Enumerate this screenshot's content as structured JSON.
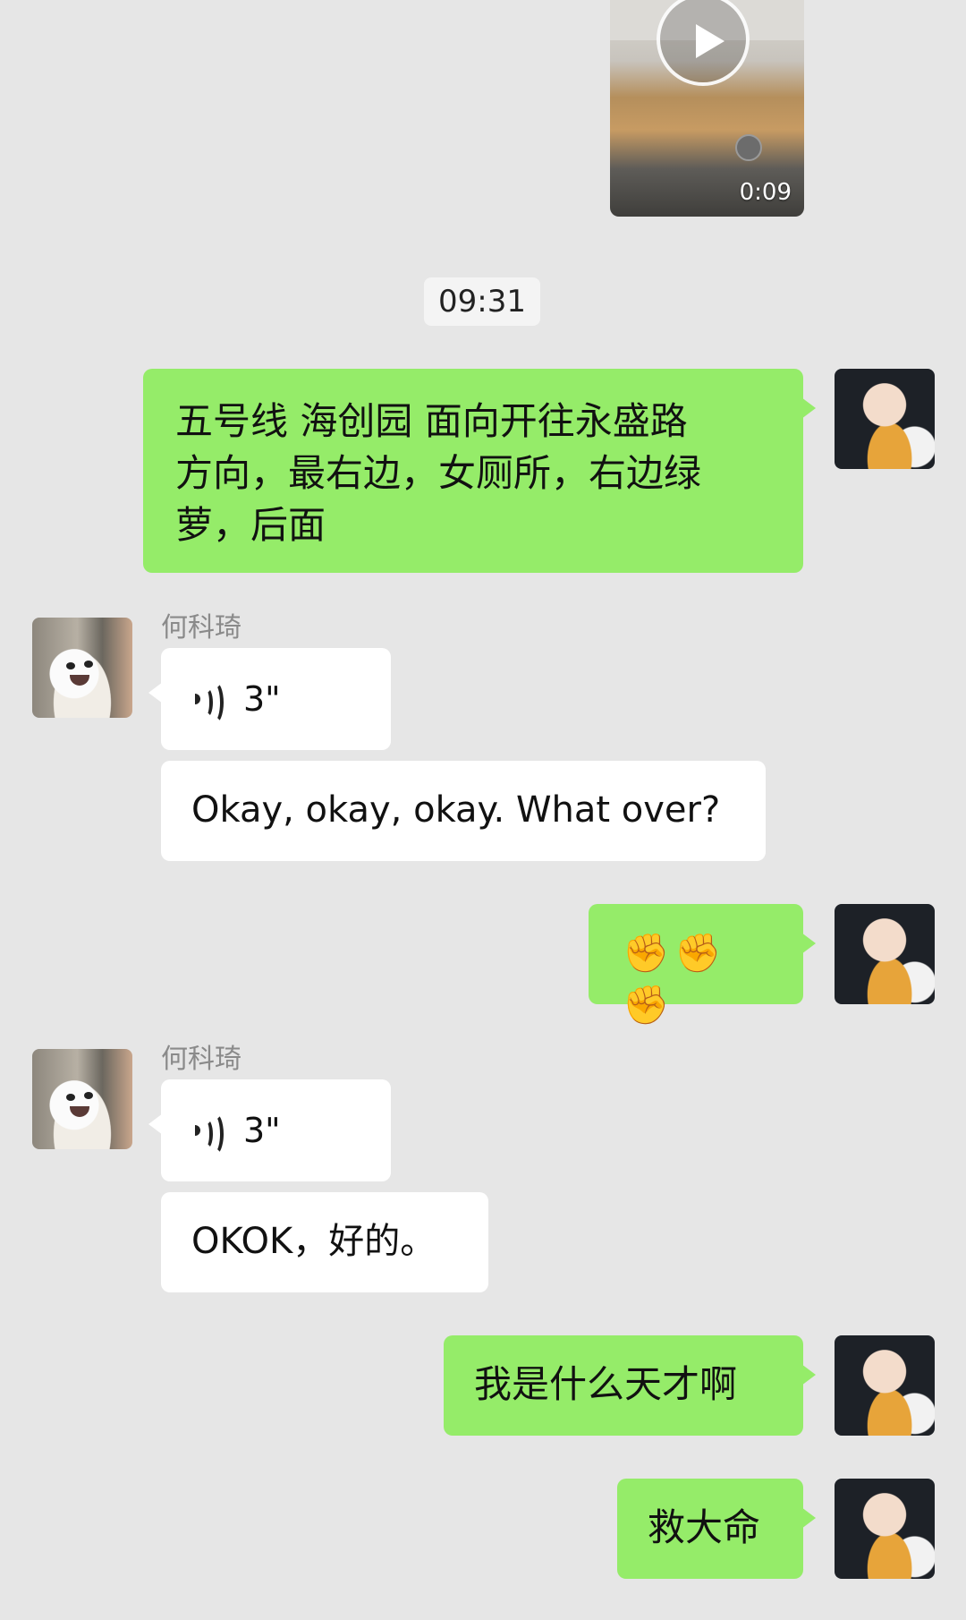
{
  "video": {
    "duration": "0:09"
  },
  "timestamp": "09:31",
  "messages": [
    {
      "from": "me",
      "text_lines": [
        "五号线 海创园 面向开往永盛路",
        "方向，最右边，女厕所，右边绿",
        "萝，后面"
      ]
    },
    {
      "from": "them",
      "sender": "何科琦",
      "voice_duration": "3\"",
      "transcript": "Okay, okay, okay. What over?"
    },
    {
      "from": "me",
      "text": "✊✊✊"
    },
    {
      "from": "them",
      "sender": "何科琦",
      "voice_duration": "3\"",
      "transcript": "OKOK，好的。"
    },
    {
      "from": "me",
      "text": "我是什么天才啊"
    },
    {
      "from": "me",
      "text": "救大命"
    }
  ],
  "colors": {
    "background": "#e6e6e6",
    "my_bubble": "#95ec69",
    "their_bubble": "#ffffff",
    "sender_name": "#8a8a8a"
  },
  "icons": [
    "play-icon",
    "voice-wave-icon"
  ]
}
